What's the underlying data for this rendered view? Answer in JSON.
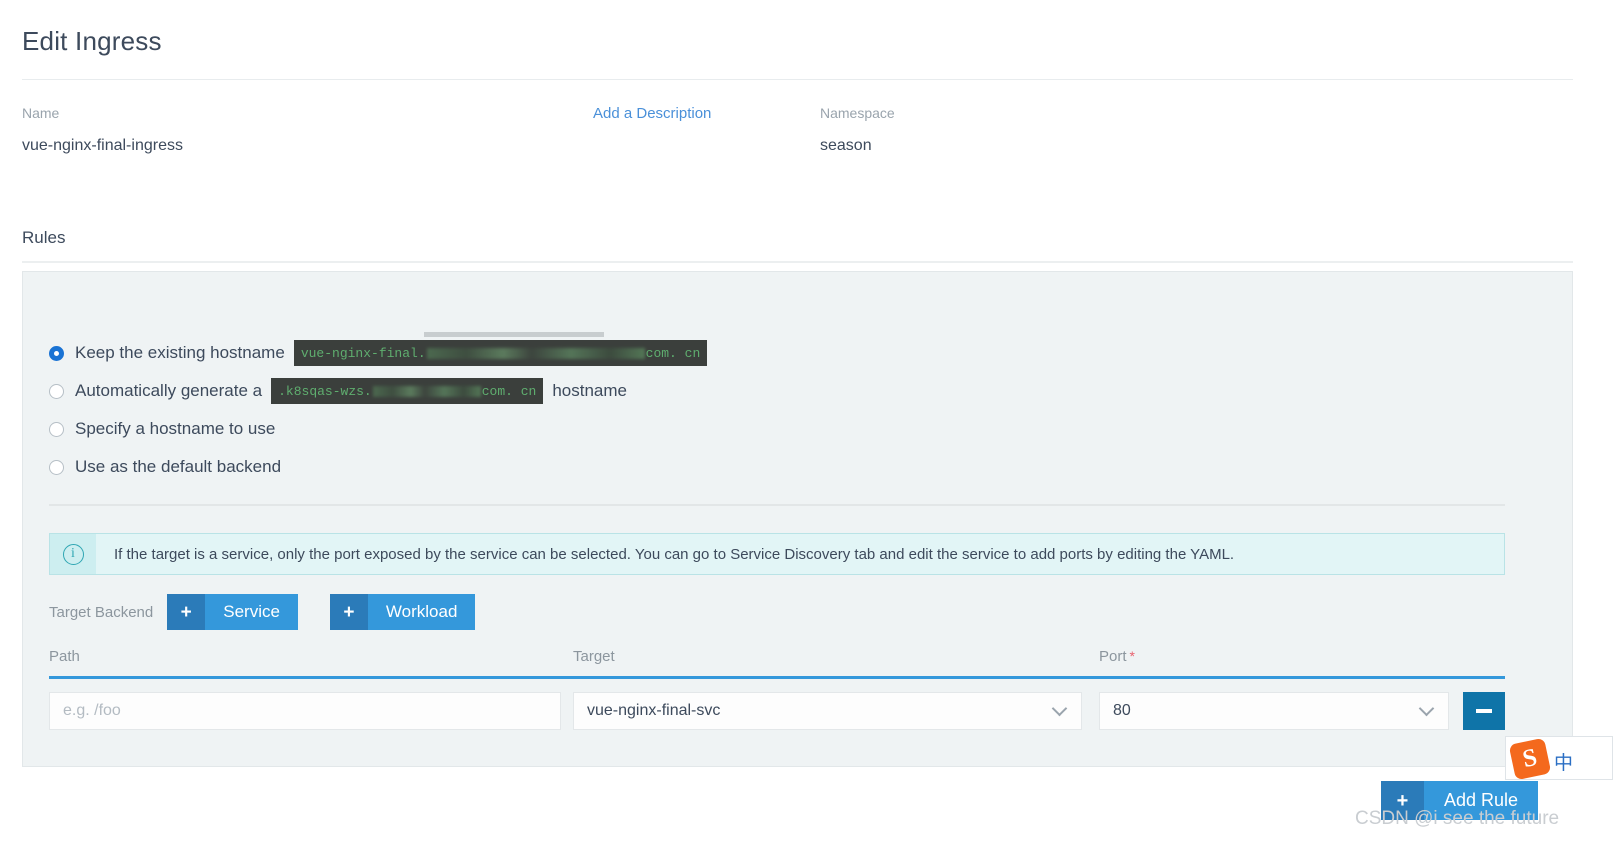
{
  "page": {
    "title": "Edit Ingress"
  },
  "meta": {
    "name_label": "Name",
    "name_value": "vue-nginx-final-ingress",
    "description_link": "Add a Description",
    "namespace_label": "Namespace",
    "namespace_value": "season"
  },
  "rules": {
    "section_title": "Rules",
    "options": [
      {
        "label": "Keep the existing hostname",
        "selected": true
      },
      {
        "label": "Automatically generate a",
        "suffix": "hostname",
        "selected": false
      },
      {
        "label": "Specify a hostname to use",
        "selected": false
      },
      {
        "label": "Use as the default backend",
        "selected": false
      }
    ],
    "existing_hostname": {
      "prefix": "vue-nginx-final.",
      "redacted": true,
      "suffix": "com. cn"
    },
    "generated_hostname": {
      "prefix": ".k8sqas-wzs.",
      "redacted": true,
      "suffix": "com. cn"
    },
    "info_banner": {
      "icon": "info-circle-icon",
      "text": "If the target is a service, only the port exposed by the service can be selected. You can go to Service Discovery tab and edit the service to add ports by editing the YAML."
    },
    "target_backend": {
      "label": "Target Backend",
      "service_button": "Service",
      "workload_button": "Workload",
      "plus_glyph": "+"
    },
    "table": {
      "columns": [
        {
          "label": "Path",
          "required": false
        },
        {
          "label": "Target",
          "required": false
        },
        {
          "label": "Port",
          "required": true
        }
      ],
      "required_marker": "*",
      "row": {
        "path_value": "",
        "path_placeholder": "e.g. /foo",
        "target_value": "vue-nginx-final-svc",
        "port_value": "80",
        "remove_label": "−"
      }
    },
    "add_rule": {
      "label": "Add Rule",
      "plus_glyph": "+"
    }
  },
  "overlay": {
    "watermark": "CSDN @i see the future",
    "ime": {
      "logo_glyph": "S",
      "mode_glyph": "中"
    }
  },
  "colors": {
    "accent_blue": "#3498db",
    "accent_blue_dark": "#2b7bb9",
    "panel_bg": "#eff3f4",
    "info_bg": "#e2f5f6",
    "info_icon": "#2fa6b3",
    "required_red": "#e8606d",
    "chip_bg": "#3b3f3c",
    "chip_text": "#5aa86a",
    "link_blue": "#4a90d9",
    "minus_blue": "#0f74a8",
    "ime_orange": "#f4691d"
  }
}
